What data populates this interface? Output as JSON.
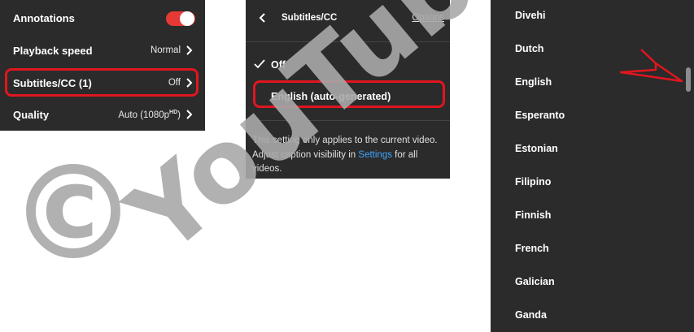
{
  "settings": {
    "annotations_label": "Annotations",
    "annotations_on": true,
    "playback_label": "Playback speed",
    "playback_value": "Normal",
    "subtitles_label": "Subtitles/CC (1)",
    "subtitles_value": "Off",
    "quality_label": "Quality",
    "quality_value": "Auto (1080p",
    "quality_badge": "HD"
  },
  "subtitles_menu": {
    "title": "Subtitles/CC",
    "options_link": "Options",
    "option_off": "Off",
    "option_english": "English (auto-generated)",
    "note_text": "This setting only applies to the current video. Adjust caption visibility in ",
    "note_link": "Settings",
    "note_tail": " for all videos."
  },
  "languages": [
    "Divehi",
    "Dutch",
    "English",
    "Esperanto",
    "Estonian",
    "Filipino",
    "Finnish",
    "French",
    "Galician",
    "Ganda"
  ],
  "watermark": {
    "text": "YouTube",
    "copyright": "©"
  },
  "colors": {
    "panel_bg": "#2b2b2b",
    "highlight_red": "#e0161f",
    "toggle_red": "#e53935",
    "link_blue": "#3ea6ff",
    "watermark_gray": "#a8a8a8"
  }
}
